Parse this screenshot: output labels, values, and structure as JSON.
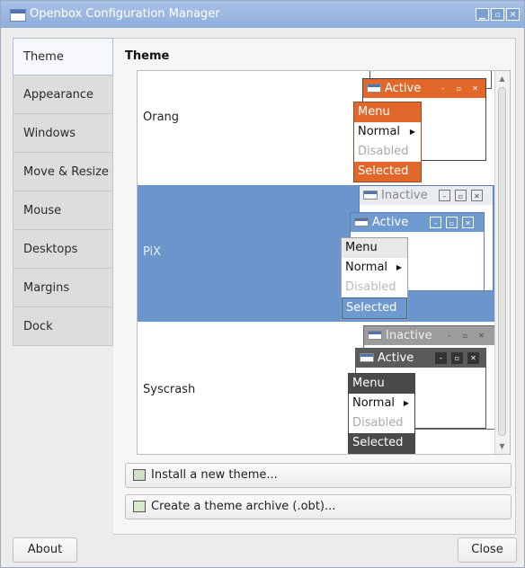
{
  "window": {
    "title": "Openbox Configuration Manager"
  },
  "tabs": [
    "Theme",
    "Appearance",
    "Windows",
    "Move & Resize",
    "Mouse",
    "Desktops",
    "Margins",
    "Dock"
  ],
  "panel": {
    "title": "Theme"
  },
  "themes": [
    {
      "name": "Orang"
    },
    {
      "name": "PiX"
    },
    {
      "name": "Syscrash"
    }
  ],
  "preview": {
    "active": "Active",
    "inactive": "Inactive",
    "menu": {
      "title": "Menu",
      "normal": "Normal",
      "disabled": "Disabled",
      "selected": "Selected"
    }
  },
  "buttons": {
    "install": "Install a new theme...",
    "archive": "Create a theme archive (.obt)...",
    "about": "About",
    "close": "Close"
  },
  "colors": {
    "selection": "#6b96cc",
    "orang_accent": "#e2672a",
    "syscrash_dark": "#555555"
  }
}
